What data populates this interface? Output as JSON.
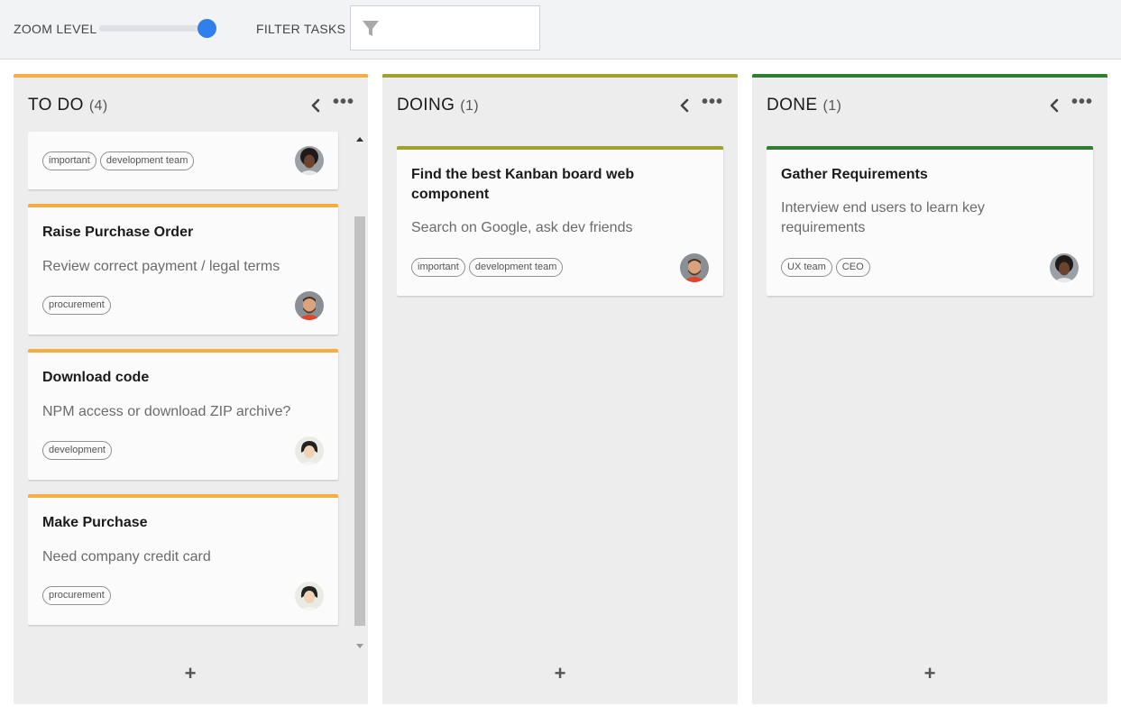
{
  "toolbar": {
    "zoom_label": "ZOOM LEVEL",
    "zoom_value_fraction": 1.0,
    "filter_label": "FILTER TASKS",
    "filter_value": "",
    "filter_icon": "filter-icon"
  },
  "colors": {
    "todo": "#f6ad42",
    "doing": "#a0a030",
    "done": "#2e7d32",
    "slider_thumb": "#2f80ed"
  },
  "columns": [
    {
      "title": "TO DO",
      "count": "(4)",
      "cards": [
        {
          "title": "",
          "description": "",
          "tags": [
            "important",
            "development team"
          ],
          "avatar": "woman-curly-hair"
        },
        {
          "title": "Raise Purchase Order",
          "description": "Review correct payment / legal terms",
          "tags": [
            "procurement"
          ],
          "avatar": "man-beard"
        },
        {
          "title": "Download code",
          "description": "NPM access or download ZIP archive?",
          "tags": [
            "development"
          ],
          "avatar": "woman-dark-hair"
        },
        {
          "title": "Make Purchase",
          "description": "Need company credit card",
          "tags": [
            "procurement"
          ],
          "avatar": "woman-dark-hair"
        }
      ],
      "add_label": "+"
    },
    {
      "title": "DOING",
      "count": "(1)",
      "cards": [
        {
          "title": "Find the best Kanban board web component",
          "description": "Search on Google, ask dev friends",
          "tags": [
            "important",
            "development team"
          ],
          "avatar": "man-beard"
        }
      ],
      "add_label": "+"
    },
    {
      "title": "DONE",
      "count": "(1)",
      "cards": [
        {
          "title": "Gather Requirements",
          "description": "Interview end users to learn key requirements",
          "tags": [
            "UX team",
            "CEO"
          ],
          "avatar": "woman-curly-hair"
        }
      ],
      "add_label": "+"
    }
  ],
  "icons": {
    "collapse": "chevron-left-icon",
    "more": "more-horizontal-icon",
    "add": "plus-icon"
  }
}
